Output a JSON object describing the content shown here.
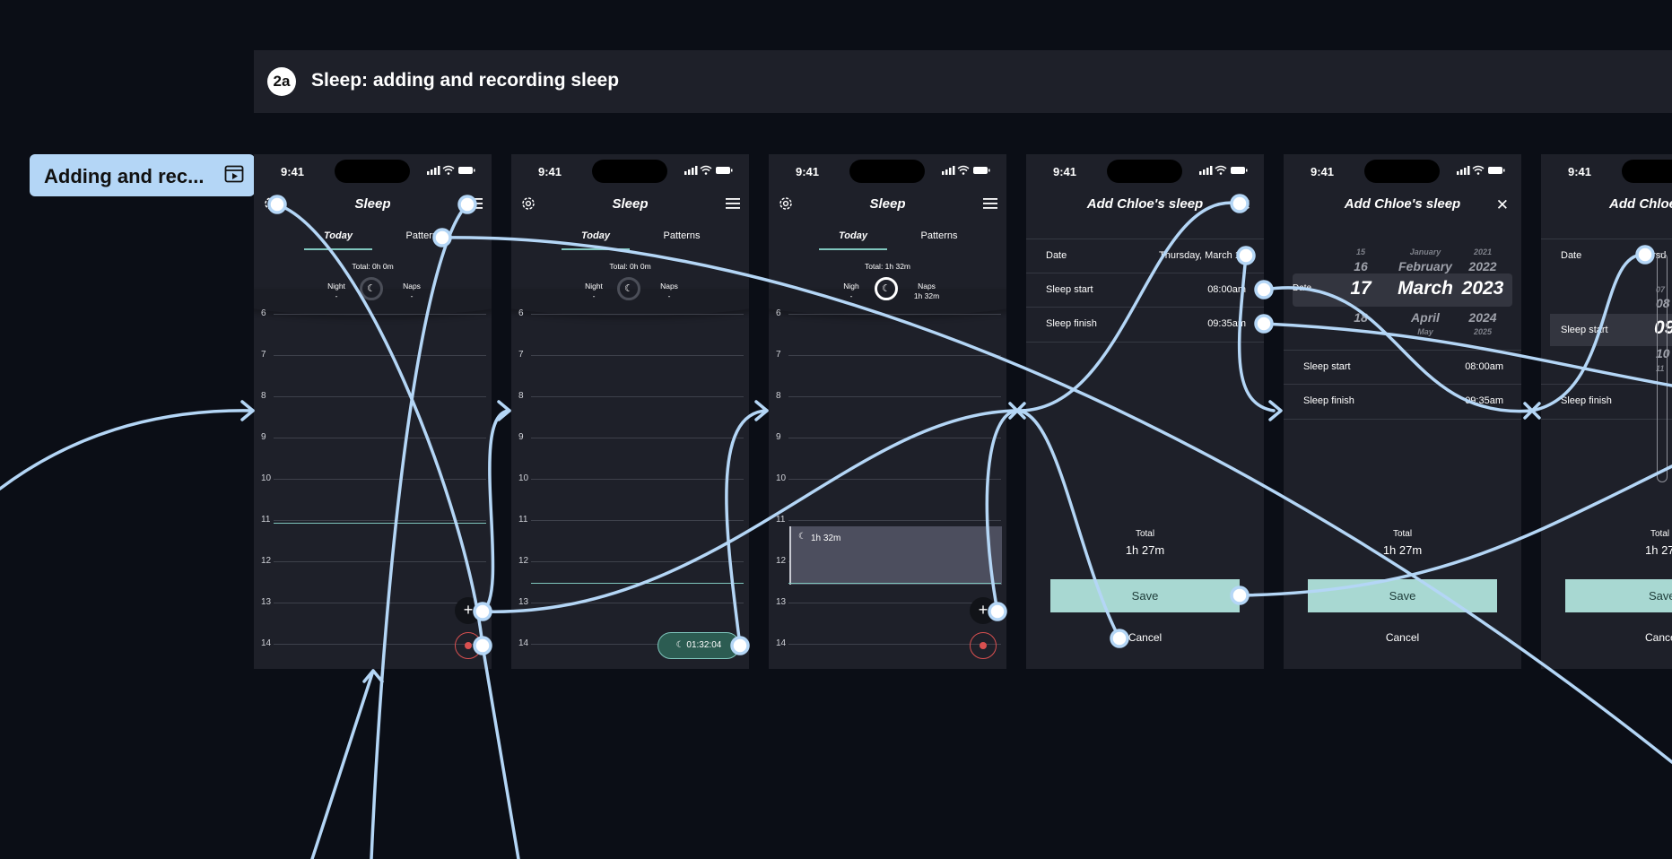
{
  "section": {
    "badge": "2a",
    "title": "Sleep: adding and recording sleep"
  },
  "flow_label": {
    "text": "Adding and rec...",
    "icon": "play-frame-icon"
  },
  "status": {
    "time": "9:41"
  },
  "timeline": {
    "app_title": "Sleep",
    "tab_today": "Today",
    "tab_patterns": "Patterns",
    "night_label": "Night",
    "naps_label": "Naps",
    "dash": "-",
    "hours": [
      "6",
      "7",
      "8",
      "9",
      "10",
      "11",
      "12",
      "13",
      "14"
    ]
  },
  "screen1": {
    "total": "Total: 0h 0m"
  },
  "screen2": {
    "total": "Total: 0h 0m",
    "timer": "01:32:04"
  },
  "screen3": {
    "total": "Total: 1h 32m",
    "naps_value": "1h 32m",
    "block_label": "1h 32m",
    "night_label_partial": "Nigh"
  },
  "form": {
    "title": "Add Chloe's sleep",
    "date_label": "Date",
    "date_value": "Thursday, March 16",
    "sleep_start_label": "Sleep start",
    "sleep_start_value": "08:00am",
    "sleep_finish_label": "Sleep finish",
    "sleep_finish_value": "09:35am",
    "total_label": "Total",
    "total_value": "1h 27m",
    "save": "Save",
    "cancel": "Cancel"
  },
  "picker": {
    "day": {
      "far_prev": "15",
      "prev": "16",
      "sel": "17",
      "next": "18"
    },
    "month": {
      "far_prev": "January",
      "prev": "February",
      "sel": "March",
      "next": "April",
      "far_next": "May"
    },
    "year": {
      "far_prev": "2021",
      "prev": "2022",
      "sel": "2023",
      "next": "2024",
      "far_next": "2025"
    }
  },
  "screen6": {
    "title_partial": "Add Chloe",
    "date_partial": "ursd",
    "time_partial": "09",
    "near": [
      "07",
      "08",
      "10",
      "11"
    ],
    "save": "Save",
    "cancel": "Cance",
    "total_value": "1h 27m"
  },
  "colors": {
    "background": "#0b0e16",
    "screen": "#1e2029",
    "connector": "#b4d6f6",
    "accent": "#7fc6bd",
    "save": "#a8d8d2",
    "record": "#d95050"
  }
}
